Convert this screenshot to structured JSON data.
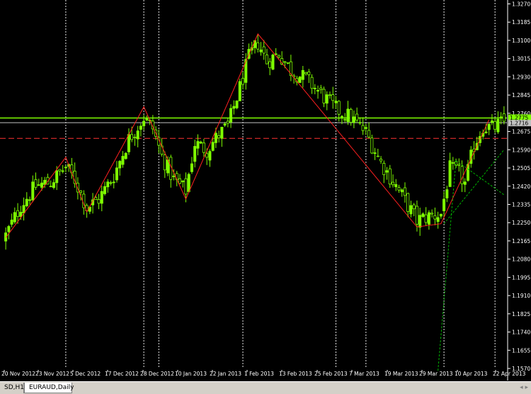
{
  "chart_data": {
    "type": "candlestick",
    "symbol": "EURAUD",
    "timeframe": "Daily",
    "ylim": [
      1.157,
      1.3275
    ],
    "y_ticks": [
      "1.3270",
      "1.3185",
      "1.3100",
      "1.3015",
      "1.2930",
      "1.2845",
      "1.2760",
      "1.2675",
      "1.2590",
      "1.2505",
      "1.2420",
      "1.2335",
      "1.2250",
      "1.2165",
      "1.2080",
      "1.1995",
      "1.1910",
      "1.1825",
      "1.1740",
      "1.1655",
      "1.1570"
    ],
    "x_ticks": [
      "20 Nov 2012",
      "23 Nov 2012",
      "5 Dec 2012",
      "17 Dec 2012",
      "28 Dec 2012",
      "10 Jan 2013",
      "22 Jan 2013",
      "1 Feb 2013",
      "13 Feb 2013",
      "25 Feb 2013",
      "7 Mar 2013",
      "19 Mar 2013",
      "29 Mar 2013",
      "10 Apr 2013",
      "22 Apr 2013"
    ],
    "price_labels": {
      "upper": "1.2775",
      "current": "1.2716"
    },
    "horizontal_levels": [
      {
        "value": 1.2738,
        "style": "solid",
        "color": "#7fff00"
      },
      {
        "value": 1.2716,
        "style": "solid",
        "color": "#c0c0c0"
      },
      {
        "value": 1.2643,
        "style": "dashed",
        "color": "#ff3333"
      }
    ],
    "zigzag": [
      {
        "bar": 0,
        "price": 1.218
      },
      {
        "bar": 20,
        "price": 1.2555
      },
      {
        "bar": 27,
        "price": 1.23
      },
      {
        "bar": 46,
        "price": 1.279
      },
      {
        "bar": 60,
        "price": 1.236
      },
      {
        "bar": 84,
        "price": 1.313
      },
      {
        "bar": 137,
        "price": 1.223
      },
      {
        "bar": 145,
        "price": 1.2245
      },
      {
        "bar": 161,
        "price": 1.273
      }
    ],
    "close_path": [
      {
        "bar": 0,
        "price": 1.219
      },
      {
        "bar": 5,
        "price": 1.233
      },
      {
        "bar": 10,
        "price": 1.242
      },
      {
        "bar": 15,
        "price": 1.244
      },
      {
        "bar": 20,
        "price": 1.251
      },
      {
        "bar": 23,
        "price": 1.245
      },
      {
        "bar": 27,
        "price": 1.232
      },
      {
        "bar": 31,
        "price": 1.236
      },
      {
        "bar": 36,
        "price": 1.247
      },
      {
        "bar": 41,
        "price": 1.264
      },
      {
        "bar": 46,
        "price": 1.274
      },
      {
        "bar": 49,
        "price": 1.269
      },
      {
        "bar": 52,
        "price": 1.256
      },
      {
        "bar": 56,
        "price": 1.245
      },
      {
        "bar": 60,
        "price": 1.24
      },
      {
        "bar": 63,
        "price": 1.262
      },
      {
        "bar": 67,
        "price": 1.259
      },
      {
        "bar": 71,
        "price": 1.266
      },
      {
        "bar": 74,
        "price": 1.27
      },
      {
        "bar": 78,
        "price": 1.288
      },
      {
        "bar": 81,
        "price": 1.302
      },
      {
        "bar": 84,
        "price": 1.309
      },
      {
        "bar": 87,
        "price": 1.3
      },
      {
        "bar": 91,
        "price": 1.304
      },
      {
        "bar": 95,
        "price": 1.296
      },
      {
        "bar": 100,
        "price": 1.292
      },
      {
        "bar": 105,
        "price": 1.285
      },
      {
        "bar": 110,
        "price": 1.278
      },
      {
        "bar": 115,
        "price": 1.274
      },
      {
        "bar": 120,
        "price": 1.267
      },
      {
        "bar": 125,
        "price": 1.253
      },
      {
        "bar": 130,
        "price": 1.242
      },
      {
        "bar": 134,
        "price": 1.233
      },
      {
        "bar": 137,
        "price": 1.226
      },
      {
        "bar": 141,
        "price": 1.228
      },
      {
        "bar": 145,
        "price": 1.229
      },
      {
        "bar": 148,
        "price": 1.25
      },
      {
        "bar": 151,
        "price": 1.248
      },
      {
        "bar": 153,
        "price": 1.243
      },
      {
        "bar": 156,
        "price": 1.261
      },
      {
        "bar": 159,
        "price": 1.27
      },
      {
        "bar": 162,
        "price": 1.269
      },
      {
        "bar": 166,
        "price": 1.272
      }
    ],
    "trend_lines": [
      {
        "from": {
          "bar": 144,
          "price": 1.156
        },
        "to": {
          "bar": 150,
          "price": 1.254
        },
        "color": "#00b000",
        "style": "dashed"
      },
      {
        "from": {
          "bar": 150,
          "price": 1.254
        },
        "to": {
          "bar": 166,
          "price": 1.238
        },
        "color": "#00b000",
        "style": "dashed"
      },
      {
        "from": {
          "bar": 146,
          "price": 1.2245
        },
        "to": {
          "bar": 166,
          "price": 1.259
        },
        "color": "#00b000",
        "style": "dashed"
      }
    ],
    "colors": {
      "background": "#000000",
      "bull": "#7fff00",
      "bear": "#000000",
      "wick": "#7fff00",
      "zigzag": "#ff2020",
      "grid_vertical": "#ffffff"
    },
    "grid": "vertical-dotted-at-period-separators"
  },
  "tabs": {
    "left_label": "SD,H1",
    "active_label": "EURAUD,Daily"
  }
}
